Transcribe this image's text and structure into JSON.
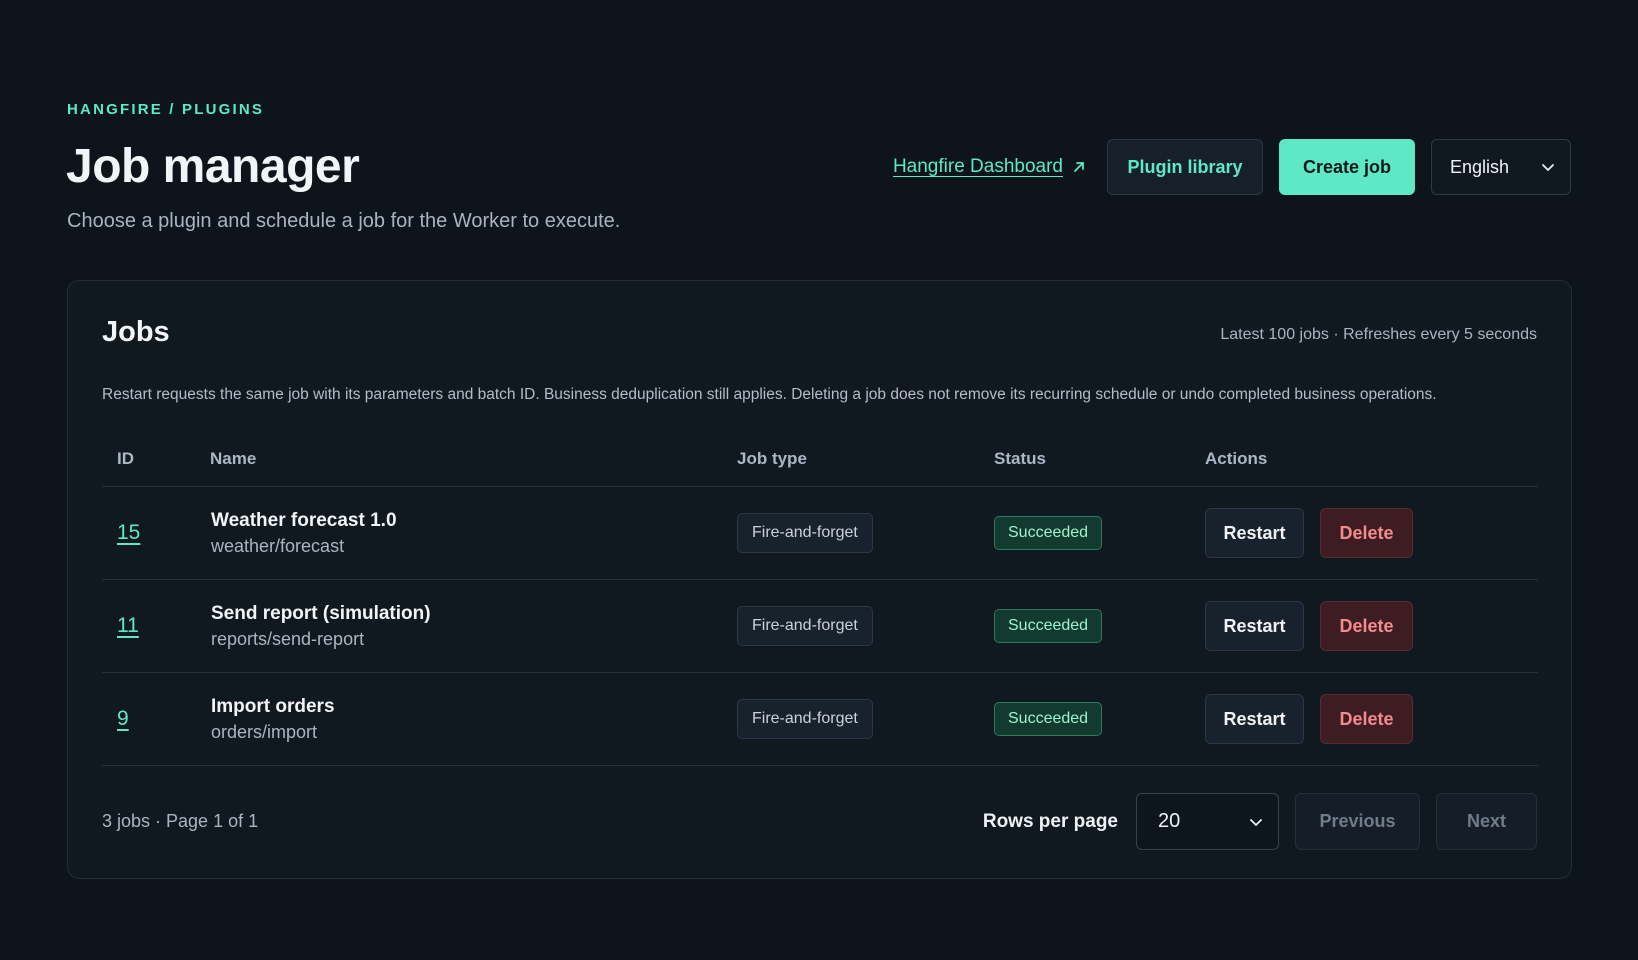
{
  "breadcrumb": "HANGFIRE / PLUGINS",
  "header": {
    "title": "Job manager",
    "subtitle": "Choose a plugin and schedule a job for the Worker to execute.",
    "dashboard_link": "Hangfire Dashboard",
    "plugin_library": "Plugin library",
    "create_job": "Create job",
    "language": "English"
  },
  "jobs_card": {
    "title": "Jobs",
    "meta": "Latest 100 jobs · Refreshes every 5 seconds",
    "note": "Restart requests the same job with its parameters and batch ID. Business deduplication still applies. Deleting a job does not remove its recurring schedule or undo completed business operations.",
    "columns": [
      "ID",
      "Name",
      "Job type",
      "Status",
      "Actions"
    ],
    "rows": [
      {
        "id": "15",
        "name": "Weather forecast 1.0",
        "path": "weather/forecast",
        "type": "Fire-and-forget",
        "status": "Succeeded",
        "restart": "Restart",
        "delete": "Delete"
      },
      {
        "id": "11",
        "name": "Send report (simulation)",
        "path": "reports/send-report",
        "type": "Fire-and-forget",
        "status": "Succeeded",
        "restart": "Restart",
        "delete": "Delete"
      },
      {
        "id": "9",
        "name": "Import orders",
        "path": "orders/import",
        "type": "Fire-and-forget",
        "status": "Succeeded",
        "restart": "Restart",
        "delete": "Delete"
      }
    ],
    "footer": {
      "summary": "3 jobs · Page 1 of 1",
      "rows_per_page_label": "Rows per page",
      "rows_per_page_value": "20",
      "previous": "Previous",
      "next": "Next"
    }
  },
  "colors": {
    "accent": "#5ee8c6",
    "background": "#0d141c",
    "success": "#9ef3cf",
    "danger": "#f38a8e"
  },
  "icons": {
    "dashboard_link": "external-link-icon",
    "language": "chevron-down-icon",
    "rows_per_page": "chevron-down-icon"
  }
}
